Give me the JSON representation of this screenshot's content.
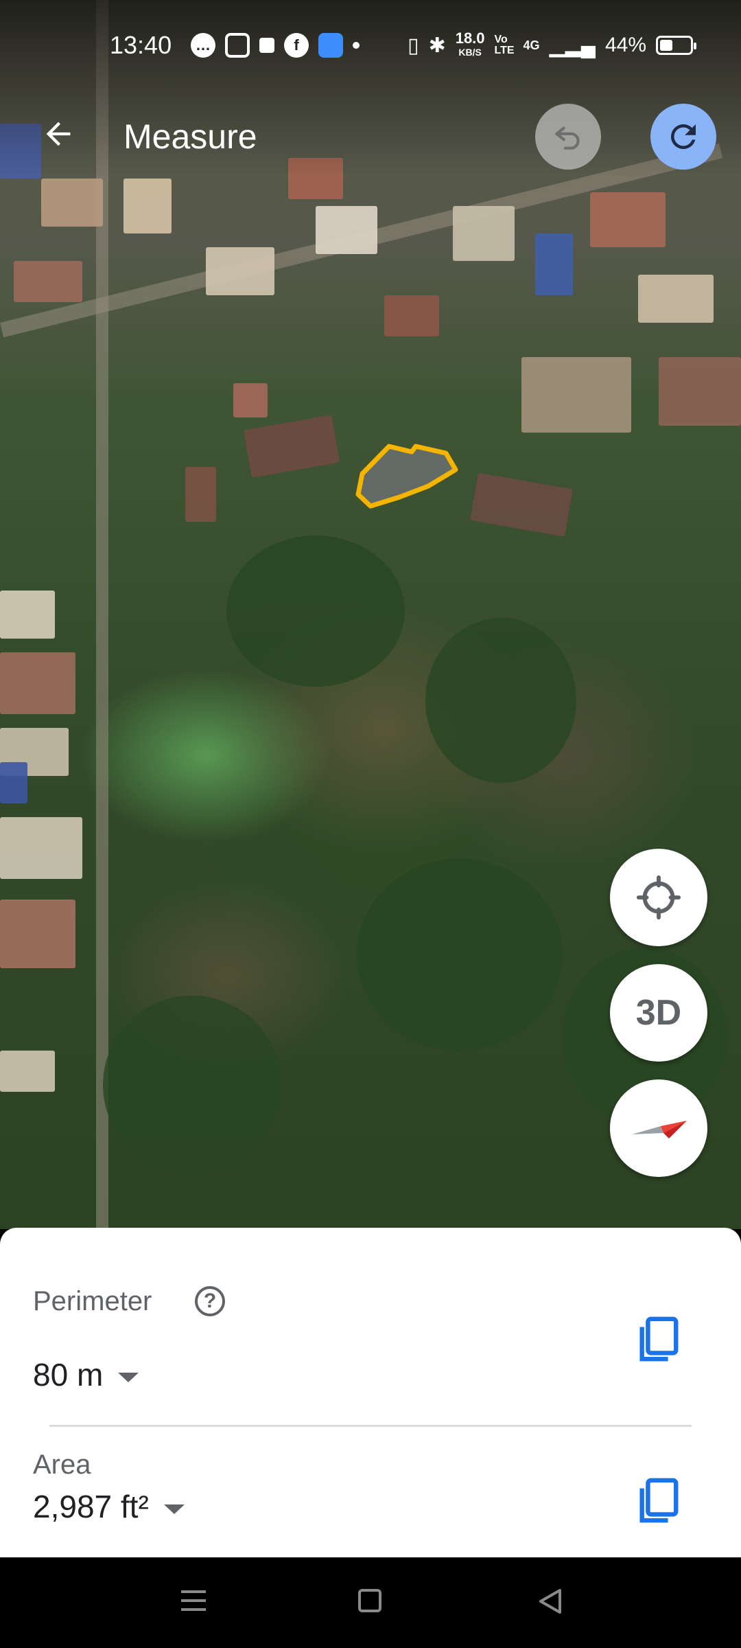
{
  "status_bar": {
    "time": "13:40",
    "net_rate_value": "18.0",
    "net_rate_unit": "KB/S",
    "volte": "Vo LTE",
    "network": "4G",
    "battery": "44%",
    "battery_level": 0.44
  },
  "app_bar": {
    "title": "Measure",
    "back_icon": "arrow-back-icon",
    "undo_icon": "undo-icon",
    "redo_icon": "redo-icon"
  },
  "map_controls": {
    "location_icon": "my-location-icon",
    "three_d_label": "3D",
    "compass_icon": "compass-icon"
  },
  "measurement": {
    "perimeter_label": "Perimeter",
    "perimeter_value": "80 m",
    "area_label": "Area",
    "area_value": "2,987 ft²",
    "copy_icon": "copy-icon",
    "help_icon": "help-icon",
    "outline_color": "#f4b400"
  },
  "nav_bar": {
    "menu_icon": "menu-icon",
    "home_icon": "home-icon",
    "back_icon": "back-triangle-icon"
  }
}
